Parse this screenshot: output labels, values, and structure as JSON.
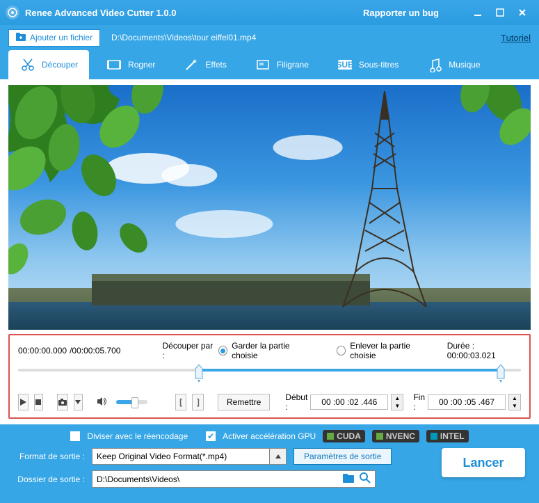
{
  "titlebar": {
    "title": "Renee Advanced Video Cutter 1.0.0",
    "bug": "Rapporter un bug"
  },
  "toolbar": {
    "add_file": "Ajouter un fichier",
    "filepath": "D:\\Documents\\Videos\\tour eiffel01.mp4",
    "tutorial": "Tutoriel"
  },
  "tabs": {
    "cut": "Découper",
    "crop": "Rogner",
    "effects": "Effets",
    "watermark": "Filigrane",
    "subtitles": "Sous-titres",
    "music": "Musique"
  },
  "timeline": {
    "current": "00:00:00.000",
    "total": "/00:00:05.700",
    "cut_by": "Découper par :",
    "keep": "Garder la partie choisie",
    "remove": "Enlever la partie choisie",
    "duration_label": "Durée :",
    "duration": "00:00:03.021",
    "reset": "Remettre",
    "start_label": "Début :",
    "start": "00 :00 :02 .446",
    "end_label": "Fin :",
    "end": "00 :00 :05 .467"
  },
  "options": {
    "split": "Diviser avec le réencodage",
    "gpu": "Activer accélération GPU",
    "badges": {
      "cuda": "CUDA",
      "nvenc": "NVENC",
      "intel": "INTEL"
    }
  },
  "output": {
    "format_label": "Format de sortie :",
    "format_value": "Keep Original Video Format(*.mp4)",
    "params": "Paramètres de sortie",
    "folder_label": "Dossier de sortie :",
    "folder_value": "D:\\Documents\\Videos\\",
    "launch": "Lancer"
  }
}
